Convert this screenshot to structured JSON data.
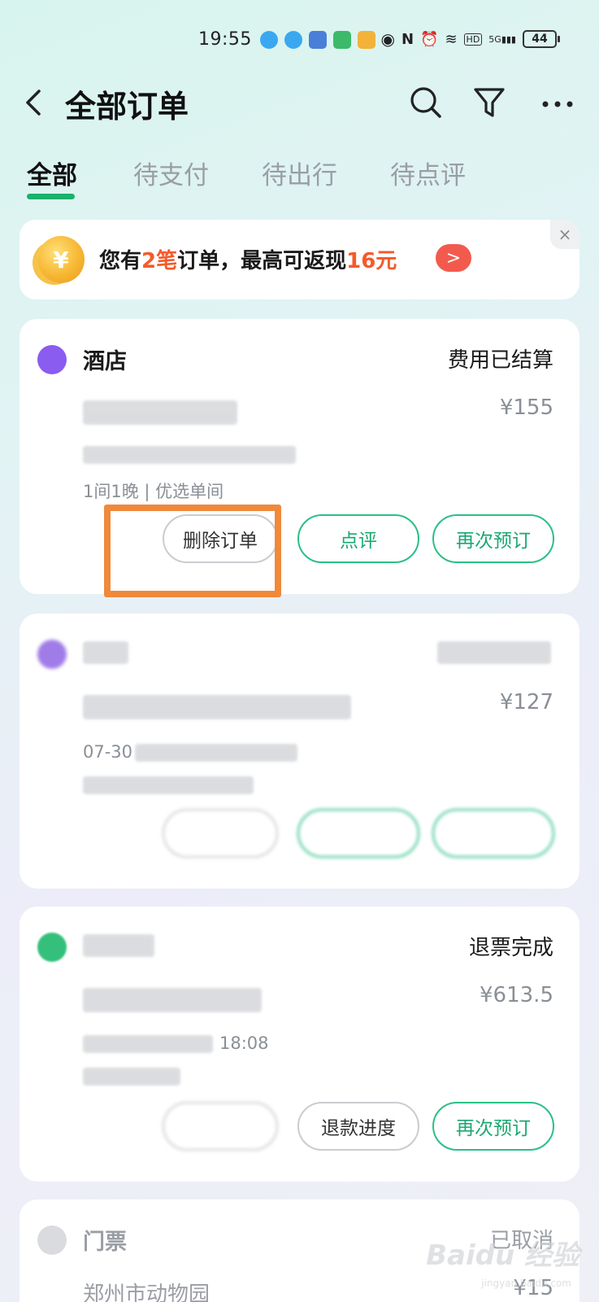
{
  "statusbar": {
    "time": "19:55",
    "battery": "44",
    "signal_label": "5G",
    "hd_label": "HD"
  },
  "header": {
    "title": "全部订单"
  },
  "tabs": [
    {
      "label": "全部",
      "active": true
    },
    {
      "label": "待支付",
      "active": false
    },
    {
      "label": "待出行",
      "active": false
    },
    {
      "label": "待点评",
      "active": false
    }
  ],
  "banner": {
    "prefix": "您有",
    "count": "2笔",
    "middle": "订单，最高可返现",
    "amount": "16元",
    "coin_symbol": "¥",
    "close_label": "×",
    "arrow_label": ">"
  },
  "orders": [
    {
      "category": "酒店",
      "status": "费用已结算",
      "price": "¥155",
      "detail": "1间1晚 | 优选单间",
      "buttons": [
        "删除订单",
        "点评",
        "再次预订"
      ]
    },
    {
      "category": "",
      "status": "",
      "price": "¥127",
      "date": "07-30",
      "buttons": [
        "",
        "",
        ""
      ]
    },
    {
      "category": "",
      "status": "退票完成",
      "price": "¥613.5",
      "time": "18:08",
      "buttons": [
        "",
        "退款进度",
        "再次预订"
      ]
    },
    {
      "category": "门票",
      "status": "已取消",
      "title": "郑州市动物园",
      "price": "¥15"
    }
  ],
  "watermark": {
    "text": "Baidu 经验",
    "sub": "jingyan.baidu.com"
  },
  "colors": {
    "accent": "#1ab16a",
    "highlight": "#f05a2c",
    "annotation": "#f0893a"
  }
}
